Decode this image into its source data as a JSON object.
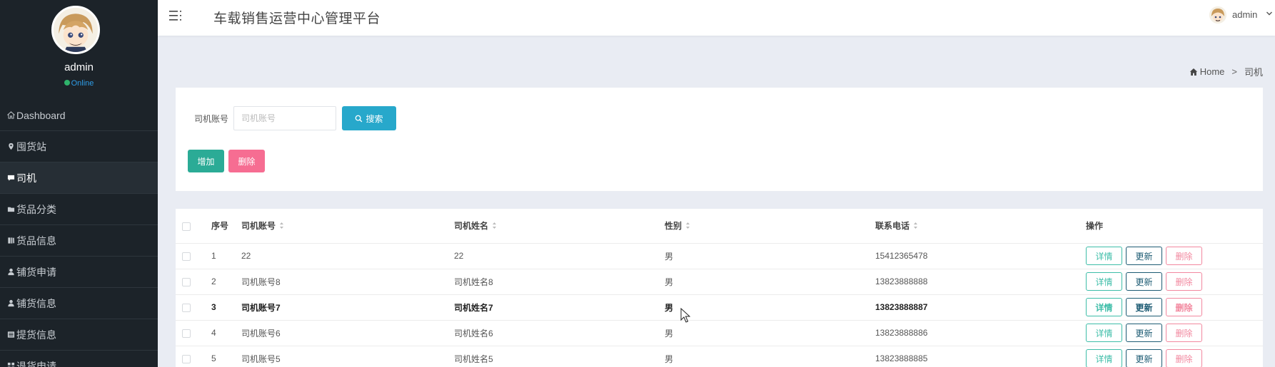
{
  "sidebar": {
    "username": "admin",
    "status": "Online",
    "items": [
      {
        "label": "Dashboard",
        "icon": "home-icon",
        "active": false
      },
      {
        "label": "囤货站",
        "icon": "map-marker-icon",
        "active": false
      },
      {
        "label": "司机",
        "icon": "comment-icon",
        "active": true
      },
      {
        "label": "货品分类",
        "icon": "folder-icon",
        "active": false
      },
      {
        "label": "货品信息",
        "icon": "book-icon",
        "active": false
      },
      {
        "label": "铺货申请",
        "icon": "user-icon",
        "active": false
      },
      {
        "label": "铺货信息",
        "icon": "user-icon",
        "active": false
      },
      {
        "label": "提货信息",
        "icon": "list-icon",
        "active": false
      },
      {
        "label": "退货申请",
        "icon": "grid-icon",
        "active": false
      }
    ]
  },
  "header": {
    "title": "车载销售运营中心管理平台",
    "user": "admin"
  },
  "breadcrumb": {
    "home": "Home",
    "sep": ">",
    "current": "司机"
  },
  "search": {
    "label": "司机账号",
    "placeholder": "司机账号",
    "button": "搜索"
  },
  "actions": {
    "add": "增加",
    "delete": "删除"
  },
  "table": {
    "headers": [
      "序号",
      "司机账号",
      "司机姓名",
      "性别",
      "联系电话",
      "操作"
    ],
    "rows": [
      {
        "index": "1",
        "account": "22",
        "name": "22",
        "gender": "男",
        "phone": "15412365478",
        "bold": false
      },
      {
        "index": "2",
        "account": "司机账号8",
        "name": "司机姓名8",
        "gender": "男",
        "phone": "13823888888",
        "bold": false
      },
      {
        "index": "3",
        "account": "司机账号7",
        "name": "司机姓名7",
        "gender": "男",
        "phone": "13823888887",
        "bold": true
      },
      {
        "index": "4",
        "account": "司机账号6",
        "name": "司机姓名6",
        "gender": "男",
        "phone": "13823888886",
        "bold": false
      },
      {
        "index": "5",
        "account": "司机账号5",
        "name": "司机姓名5",
        "gender": "男",
        "phone": "13823888885",
        "bold": false
      }
    ],
    "row_actions": {
      "detail": "详情",
      "update": "更新",
      "delete": "删除"
    }
  },
  "colors": {
    "sidebar_bg": "#1c2329",
    "search_btn": "#27a8cb",
    "add_btn": "#2bab96",
    "delete_btn": "#f66d92",
    "online": "#2fb36b"
  }
}
